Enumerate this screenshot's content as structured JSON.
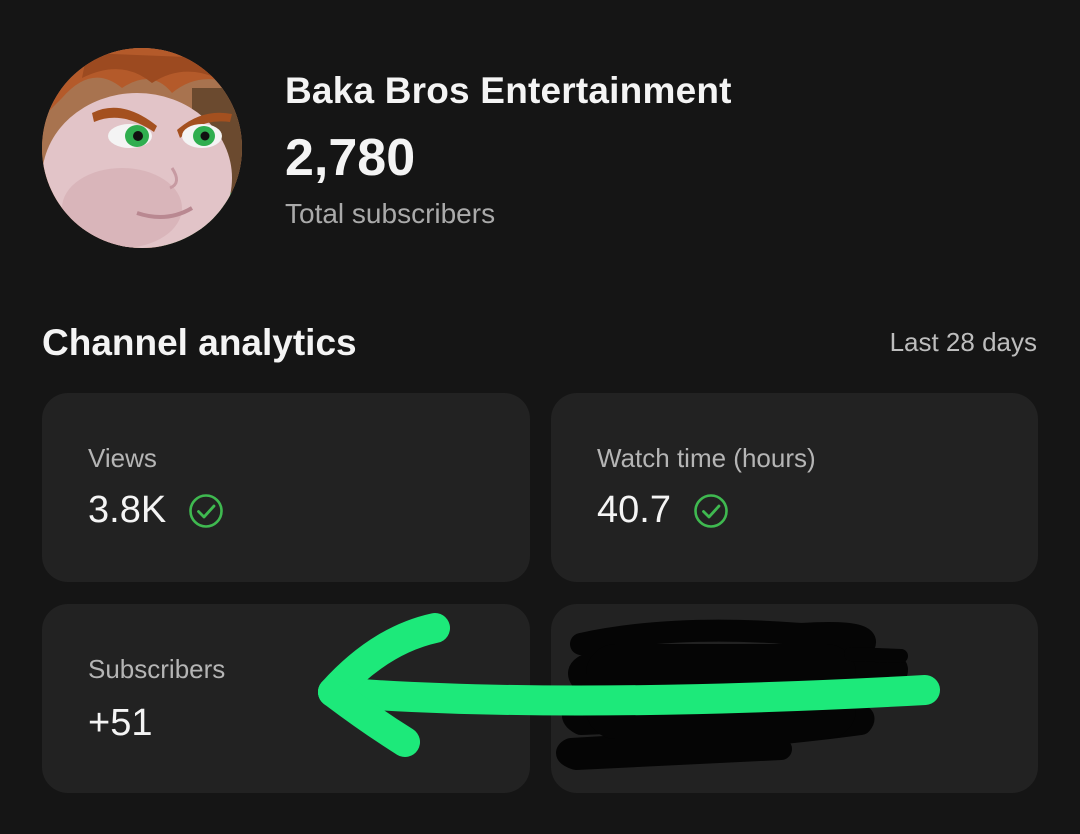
{
  "channel": {
    "name": "Baka Bros Entertainment",
    "subscriber_count": "2,780",
    "subscriber_label": "Total subscribers",
    "avatar_icon": "cartoon-character-avatar"
  },
  "analytics": {
    "title": "Channel analytics",
    "period": "Last 28 days",
    "cards": [
      {
        "label": "Views",
        "value": "3.8K",
        "status_icon": "check-circle-icon"
      },
      {
        "label": "Watch time (hours)",
        "value": "40.7",
        "status_icon": "check-circle-icon"
      },
      {
        "label": "Subscribers",
        "value": "+51"
      },
      {
        "label": "",
        "value": "",
        "redacted": true
      }
    ]
  },
  "colors": {
    "background": "#151515",
    "card": "#222222",
    "check": "#3fb950",
    "annotation_arrow": "#1de97a"
  },
  "annotation": {
    "type": "hand-drawn arrow",
    "points_to": "Subscribers"
  }
}
